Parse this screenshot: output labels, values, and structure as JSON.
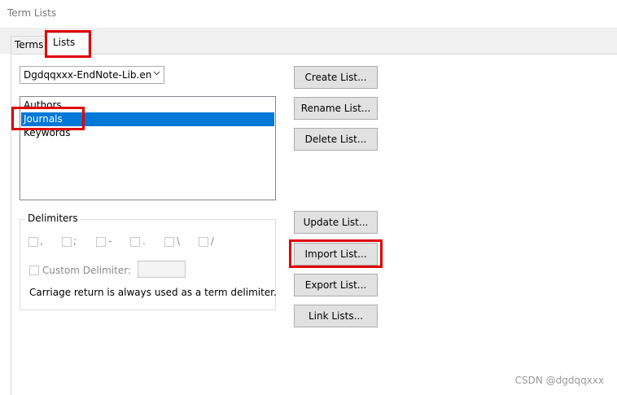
{
  "window": {
    "title": "Term Lists"
  },
  "tabs": [
    {
      "label": "Terms"
    },
    {
      "label": "Lists"
    }
  ],
  "library_select": {
    "value": "Dgdqqxxx-EndNote-Lib.en"
  },
  "term_lists": [
    {
      "label": "Authors"
    },
    {
      "label": "Journals"
    },
    {
      "label": "Keywords"
    }
  ],
  "delimiters": {
    "label": "Delimiters",
    "options": [
      {
        "label": ","
      },
      {
        "label": ";"
      },
      {
        "label": "-"
      },
      {
        "label": "."
      },
      {
        "label": "\\"
      },
      {
        "label": "/"
      }
    ],
    "custom_label": "Custom Delimiter:",
    "custom_value": "",
    "note": "Carriage return is always used as a term delimiter."
  },
  "buttons": {
    "create": "Create List...",
    "rename": "Rename List...",
    "delete": "Delete List...",
    "update": "Update List...",
    "import": "Import List...",
    "export": "Export List...",
    "link": "Link Lists..."
  },
  "watermark": "CSDN @dgdqqxxx",
  "colors": {
    "selection": "#0078d7",
    "highlight": "#e00000"
  }
}
